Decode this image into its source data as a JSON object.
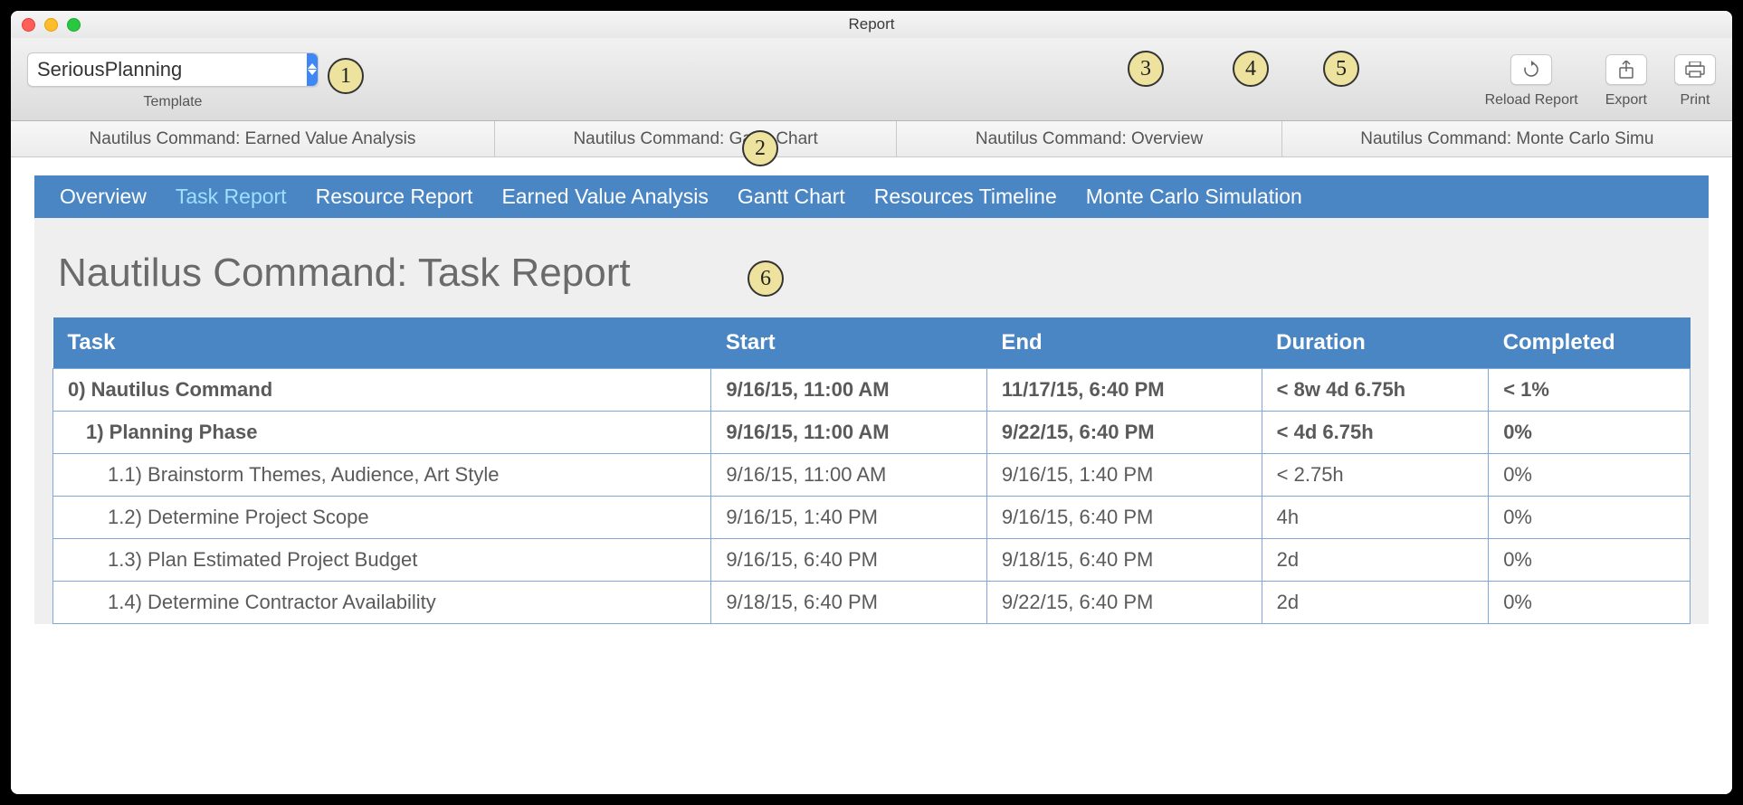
{
  "window": {
    "title": "Report"
  },
  "toolbar": {
    "template_value": "SeriousPlanning",
    "template_label": "Template",
    "reload_label": "Reload Report",
    "export_label": "Export",
    "print_label": "Print"
  },
  "tabs": [
    "Nautilus Command: Earned Value Analysis",
    "Nautilus Command: Gantt Chart",
    "Nautilus Command: Overview",
    "Nautilus Command: Monte Carlo Simu"
  ],
  "subnav": {
    "items": [
      "Overview",
      "Task Report",
      "Resource Report",
      "Earned Value Analysis",
      "Gantt Chart",
      "Resources Timeline",
      "Monte Carlo Simulation"
    ],
    "active_index": 1
  },
  "report": {
    "project": "Nautilus Command:",
    "section": "Task Report",
    "columns": [
      "Task",
      "Start",
      "End",
      "Duration",
      "Completed"
    ],
    "rows": [
      {
        "level": 0,
        "task": "0) Nautilus Command",
        "start": "9/16/15, 11:00 AM",
        "end": "11/17/15, 6:40 PM",
        "duration": "< 8w 4d 6.75h",
        "completed": "< 1%"
      },
      {
        "level": 1,
        "task": "1) Planning Phase",
        "start": "9/16/15, 11:00 AM",
        "end": "9/22/15, 6:40 PM",
        "duration": "< 4d 6.75h",
        "completed": "0%"
      },
      {
        "level": 2,
        "task": "1.1) Brainstorm Themes, Audience, Art Style",
        "start": "9/16/15, 11:00 AM",
        "end": "9/16/15, 1:40 PM",
        "duration": "< 2.75h",
        "completed": "0%"
      },
      {
        "level": 2,
        "task": "1.2) Determine Project Scope",
        "start": "9/16/15, 1:40 PM",
        "end": "9/16/15, 6:40 PM",
        "duration": "4h",
        "completed": "0%"
      },
      {
        "level": 2,
        "task": "1.3) Plan Estimated Project Budget",
        "start": "9/16/15, 6:40 PM",
        "end": "9/18/15, 6:40 PM",
        "duration": "2d",
        "completed": "0%"
      },
      {
        "level": 2,
        "task": "1.4) Determine Contractor Availability",
        "start": "9/18/15, 6:40 PM",
        "end": "9/22/15, 6:40 PM",
        "duration": "2d",
        "completed": "0%"
      }
    ]
  },
  "callouts": {
    "c1": "1",
    "c2": "2",
    "c3": "3",
    "c4": "4",
    "c5": "5",
    "c6": "6"
  }
}
